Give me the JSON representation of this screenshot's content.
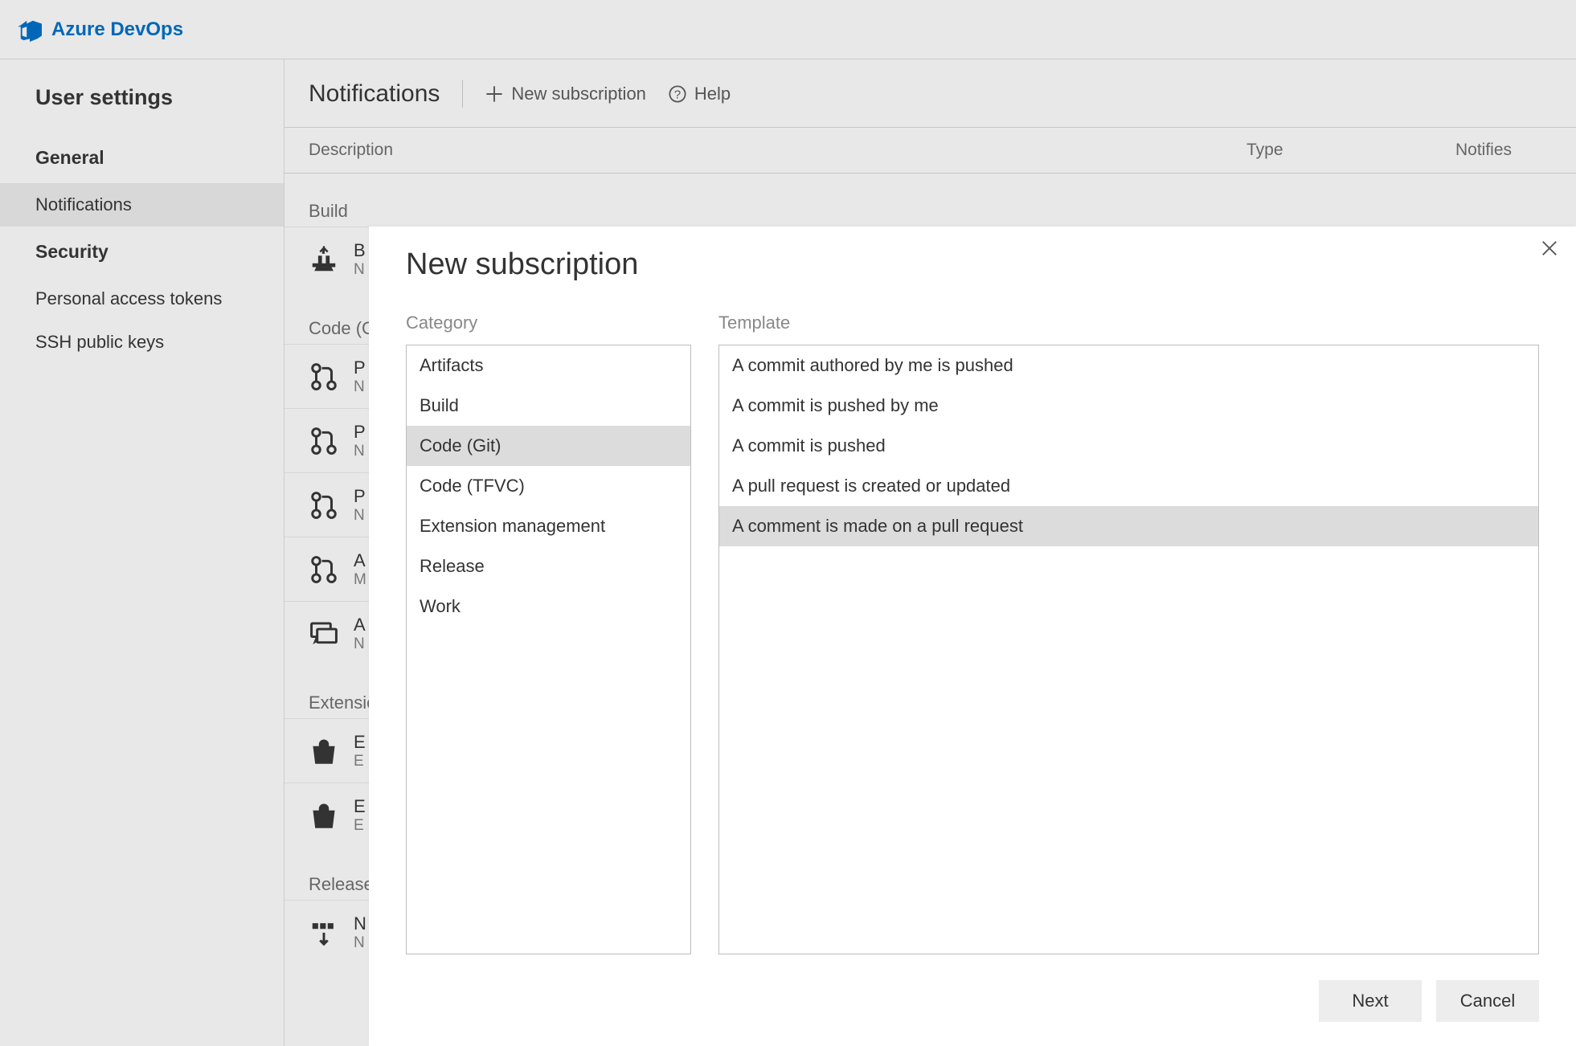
{
  "brand": "Azure DevOps",
  "sidebar": {
    "title": "User settings",
    "general_header": "General",
    "security_header": "Security",
    "items_general": [
      "Notifications"
    ],
    "items_security": [
      "Personal access tokens",
      "SSH public keys"
    ],
    "selected": "Notifications"
  },
  "main": {
    "title": "Notifications",
    "new_label": "New subscription",
    "help_label": "Help",
    "columns": {
      "desc": "Description",
      "type": "Type",
      "notifies": "Notifies"
    },
    "groups": [
      {
        "name": "Build",
        "rows": [
          {
            "icon": "build",
            "title": "B",
            "sub": "N"
          }
        ]
      },
      {
        "name": "Code (G",
        "rows": [
          {
            "icon": "pr",
            "title": "P",
            "sub": "N"
          },
          {
            "icon": "pr",
            "title": "P",
            "sub": "N"
          },
          {
            "icon": "pr",
            "title": "P",
            "sub": "N"
          },
          {
            "icon": "pr",
            "title": "A",
            "sub": "M"
          },
          {
            "icon": "comment",
            "title": "A",
            "sub": "N"
          }
        ]
      },
      {
        "name": "Extensic",
        "rows": [
          {
            "icon": "bag",
            "title": "E",
            "sub": "E"
          },
          {
            "icon": "bag",
            "title": "E",
            "sub": "E"
          }
        ]
      },
      {
        "name": "Release",
        "rows": [
          {
            "icon": "release",
            "title": "N",
            "sub": "N"
          }
        ]
      }
    ]
  },
  "modal": {
    "title": "New subscription",
    "category_label": "Category",
    "template_label": "Template",
    "categories": [
      "Artifacts",
      "Build",
      "Code (Git)",
      "Code (TFVC)",
      "Extension management",
      "Release",
      "Work"
    ],
    "selected_category": "Code (Git)",
    "templates": [
      "A commit authored by me is pushed",
      "A commit is pushed by me",
      "A commit is pushed",
      "A pull request is created or updated",
      "A comment is made on a pull request"
    ],
    "selected_template": "A comment is made on a pull request",
    "next_label": "Next",
    "cancel_label": "Cancel"
  }
}
